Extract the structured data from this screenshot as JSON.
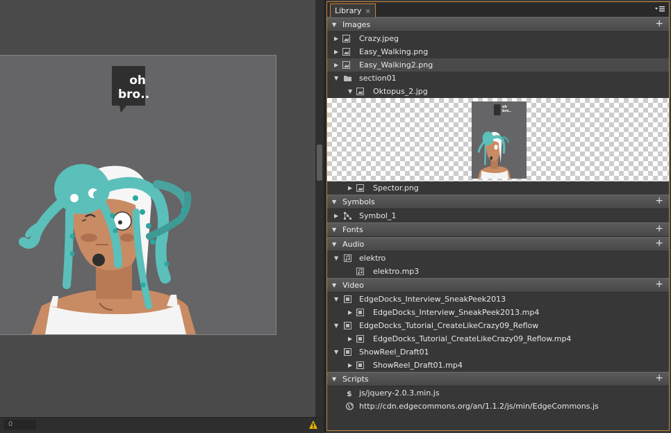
{
  "stage": {
    "speech_line1": "oh",
    "speech_line2": "bro..",
    "status_value": "0"
  },
  "library": {
    "tab_label": "Library",
    "tab_close": "×",
    "sections": {
      "images": "Images",
      "symbols": "Symbols",
      "fonts": "Fonts",
      "audio": "Audio",
      "video": "Video",
      "scripts": "Scripts"
    },
    "images": {
      "crazy": "Crazy.jpeg",
      "easy_walking": "Easy_Walking.png",
      "easy_walking2": "Easy_Walking2.png",
      "section01": "section01",
      "oktopus": "Oktopus_2.jpg",
      "spector": "Spector.png",
      "thumb_speech1": "oh",
      "thumb_speech2": "bro.."
    },
    "symbols": {
      "symbol1": "Symbol_1"
    },
    "audio": {
      "folder": "elektro",
      "file": "elektro.mp3"
    },
    "video": {
      "folder1": "EdgeDocks_Interview_SneakPeek2013",
      "file1": "EdgeDocks_Interview_SneakPeek2013.mp4",
      "folder2": "EdgeDocks_Tutorial_CreateLikeCrazy09_Reflow",
      "file2": "EdgeDocks_Tutorial_CreateLikeCrazy09_Reflow.mp4",
      "folder3": "ShowReel_Draft01",
      "file3": "ShowReel_Draft01.mp4"
    },
    "scripts": {
      "local": "js/jquery-2.0.3.min.js",
      "remote": "http://cdn.edgecommons.org/an/1.1.2/js/min/EdgeCommons.js"
    }
  },
  "colors": {
    "panel_border": "#c9853a",
    "octopus": "#5bbfba",
    "skin": "#c98b63",
    "stage_bg": "#656466"
  },
  "icons": [
    "image-icon",
    "folder-icon",
    "symbol-icon",
    "audio-icon",
    "video-icon",
    "script-icon",
    "globe-icon",
    "warning-icon",
    "panel-menu-icon",
    "plus-icon"
  ]
}
